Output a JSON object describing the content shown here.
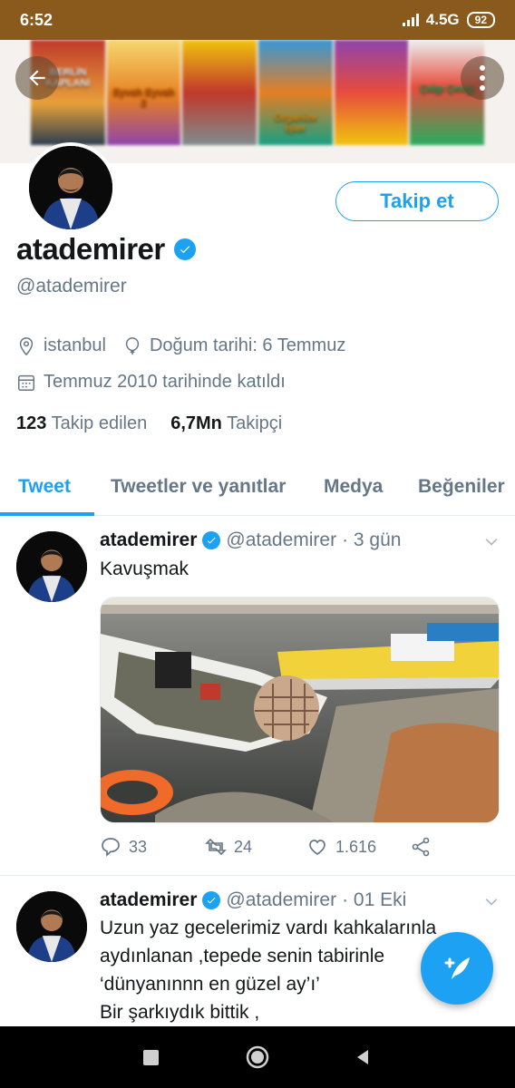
{
  "status_bar": {
    "time": "6:52",
    "network": "4.5G",
    "battery": "92"
  },
  "profile": {
    "display_name": "atademirer",
    "handle": "@atademirer",
    "follow_label": "Takip et",
    "location": "istanbul",
    "birthday": "Doğum tarihi: 6 Temmuz",
    "joined": "Temmuz 2010 tarihinde katıldı",
    "following_count": "123",
    "following_label": "Takip edilen",
    "followers_count": "6,7Mn",
    "followers_label": "Takipçi"
  },
  "banner": {
    "poster_titles": [
      "BERLİN KAPLANI",
      "Eyvah Eyvah 2",
      "",
      "Organize İşler",
      "",
      "Çalgı Çengi"
    ]
  },
  "tabs": [
    "Tweet",
    "Tweetler ve yanıtlar",
    "Medya",
    "Beğeniler"
  ],
  "tweets": [
    {
      "name": "atademirer",
      "handle": "@atademirer",
      "time": "· 3 gün",
      "text": "Kavuşmak",
      "replies": "33",
      "retweets": "24",
      "likes": "1.616"
    },
    {
      "name": "atademirer",
      "handle": "@atademirer",
      "time": "· 01 Eki",
      "text": "Uzun yaz gecelerimiz vardı kahkalarınla\naydınlanan ,tepede senin tabirinle\n‘dünyanınnn en güzel ay’ı’\nBir şarkıydık bittik ,"
    }
  ],
  "colors": {
    "accent": "#1da1f2",
    "status_bar": "#8a5a1c",
    "secondary_text": "#657786"
  },
  "icons": [
    "back-arrow-icon",
    "more-vertical-icon",
    "verified-badge-icon",
    "location-pin-icon",
    "balloon-icon",
    "calendar-icon",
    "chevron-down-icon",
    "reply-icon",
    "retweet-icon",
    "like-icon",
    "share-icon",
    "compose-tweet-icon",
    "nav-recents-icon",
    "nav-home-icon",
    "nav-back-icon"
  ]
}
